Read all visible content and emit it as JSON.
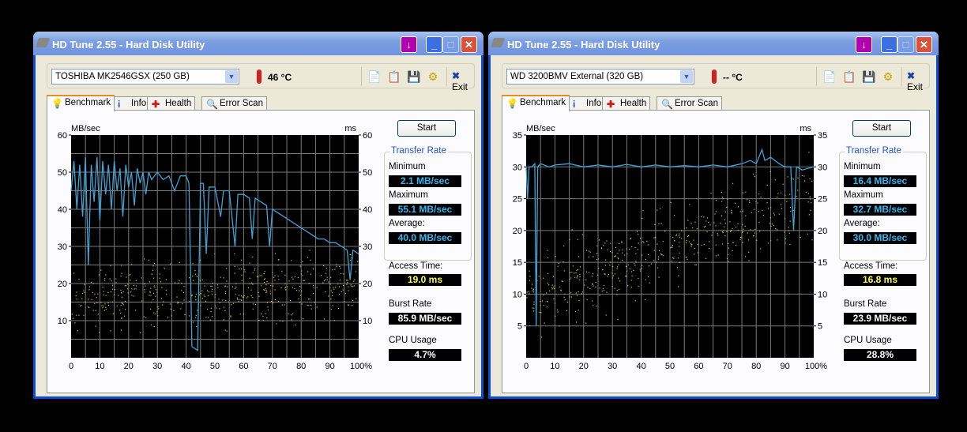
{
  "windows": [
    {
      "title": "HD Tune 2.55 - Hard Disk Utility",
      "drive": "TOSHIBA MK2546GSX (250 GB)",
      "temperature": "46 °C",
      "exit_label": "Exit",
      "tabs": [
        "Benchmark",
        "Info",
        "Health",
        "Error Scan"
      ],
      "start_label": "Start",
      "transfer_rate_label": "Transfer Rate",
      "minimum_label": "Minimum",
      "minimum": "2.1 MB/sec",
      "maximum_label": "Maximum",
      "maximum": "55.1 MB/sec",
      "average_label": "Average:",
      "average": "40.0 MB/sec",
      "access_time_label": "Access Time:",
      "access_time": "19.0 ms",
      "burst_rate_label": "Burst Rate",
      "burst_rate": "85.9 MB/sec",
      "cpu_usage_label": "CPU Usage",
      "cpu_usage": "4.7%"
    },
    {
      "title": "HD Tune 2.55 - Hard Disk Utility",
      "drive": "WD     3200BMV External (320 GB)",
      "temperature": "-- °C",
      "exit_label": "Exit",
      "tabs": [
        "Benchmark",
        "Info",
        "Health",
        "Error Scan"
      ],
      "start_label": "Start",
      "transfer_rate_label": "Transfer Rate",
      "minimum_label": "Minimum",
      "minimum": "16.4 MB/sec",
      "maximum_label": "Maximum",
      "maximum": "32.7 MB/sec",
      "average_label": "Average:",
      "average": "30.0 MB/sec",
      "access_time_label": "Access Time:",
      "access_time": "16.8 ms",
      "burst_rate_label": "Burst Rate",
      "burst_rate": "23.9 MB/sec",
      "cpu_usage_label": "CPU Usage",
      "cpu_usage": "28.8%"
    }
  ],
  "colors": {
    "line": "#3FA3D8",
    "scatter": "#C8C848",
    "grid": "#7A7A7A"
  },
  "chart_data": [
    {
      "type": "line",
      "ylabel": "MB/sec",
      "y2label": "ms",
      "ylim": [
        0,
        60
      ],
      "y2lim": [
        0,
        60
      ],
      "xlim": [
        0,
        100
      ],
      "yticks": [
        "10",
        "20",
        "30",
        "40",
        "50",
        "60"
      ],
      "y2ticks": [
        "10",
        "20",
        "30",
        "40",
        "50",
        "60"
      ],
      "xticks": [
        "0",
        "10",
        "20",
        "30",
        "40",
        "50",
        "60",
        "70",
        "80",
        "90",
        "100%"
      ],
      "transfer_rate": [
        [
          0,
          45
        ],
        [
          1,
          53
        ],
        [
          2,
          40
        ],
        [
          3,
          52
        ],
        [
          4,
          38
        ],
        [
          5,
          54
        ],
        [
          6,
          25
        ],
        [
          7,
          52
        ],
        [
          8,
          42
        ],
        [
          9,
          54
        ],
        [
          10,
          37
        ],
        [
          11,
          53
        ],
        [
          12,
          44
        ],
        [
          13,
          52
        ],
        [
          14,
          40
        ],
        [
          15,
          53
        ],
        [
          16,
          45
        ],
        [
          17,
          51
        ],
        [
          18,
          38
        ],
        [
          19,
          52
        ],
        [
          20,
          46
        ],
        [
          21,
          50
        ],
        [
          22,
          41
        ],
        [
          23,
          51
        ],
        [
          24,
          47
        ],
        [
          25,
          50
        ],
        [
          26,
          44
        ],
        [
          27,
          50
        ],
        [
          28,
          48
        ],
        [
          30,
          50
        ],
        [
          32,
          48
        ],
        [
          34,
          49
        ],
        [
          36,
          45
        ],
        [
          38,
          49
        ],
        [
          40,
          49
        ],
        [
          41,
          47
        ],
        [
          42,
          3
        ],
        [
          44,
          2
        ],
        [
          45,
          47
        ],
        [
          46,
          47
        ],
        [
          47,
          28
        ],
        [
          48,
          46
        ],
        [
          50,
          46
        ],
        [
          52,
          38
        ],
        [
          53,
          45
        ],
        [
          55,
          45
        ],
        [
          57,
          30
        ],
        [
          58,
          44
        ],
        [
          60,
          44
        ],
        [
          62,
          43
        ],
        [
          63,
          32
        ],
        [
          64,
          43
        ],
        [
          66,
          42
        ],
        [
          68,
          41
        ],
        [
          69,
          30
        ],
        [
          70,
          40
        ],
        [
          72,
          39
        ],
        [
          74,
          38
        ],
        [
          76,
          37
        ],
        [
          78,
          36
        ],
        [
          80,
          35
        ],
        [
          82,
          34
        ],
        [
          84,
          33
        ],
        [
          86,
          32
        ],
        [
          88,
          32
        ],
        [
          90,
          31
        ],
        [
          92,
          31
        ],
        [
          94,
          30
        ],
        [
          96,
          29
        ],
        [
          97,
          21
        ],
        [
          98,
          29
        ],
        [
          100,
          28
        ]
      ],
      "access_time_cloud": {
        "count": 500,
        "ms_center_start": 16,
        "ms_center_end": 20,
        "ms_spread": 7
      }
    },
    {
      "type": "line",
      "ylabel": "MB/sec",
      "y2label": "ms",
      "ylim": [
        0,
        35
      ],
      "y2lim": [
        0,
        35
      ],
      "xlim": [
        0,
        100
      ],
      "yticks": [
        "5",
        "10",
        "15",
        "20",
        "25",
        "30",
        "35"
      ],
      "y2ticks": [
        "5",
        "10",
        "15",
        "20",
        "25",
        "30",
        "35"
      ],
      "xticks": [
        "0",
        "10",
        "20",
        "30",
        "40",
        "50",
        "60",
        "70",
        "80",
        "90",
        "100%"
      ],
      "transfer_rate": [
        [
          0,
          30
        ],
        [
          0.5,
          25
        ],
        [
          1,
          30
        ],
        [
          2,
          30
        ],
        [
          3,
          30.5
        ],
        [
          3.5,
          5
        ],
        [
          4,
          30
        ],
        [
          5,
          30.5
        ],
        [
          8,
          30
        ],
        [
          10,
          30.3
        ],
        [
          15,
          30.5
        ],
        [
          20,
          30
        ],
        [
          25,
          30.3
        ],
        [
          30,
          30
        ],
        [
          35,
          30.4
        ],
        [
          40,
          30
        ],
        [
          45,
          30.3
        ],
        [
          50,
          30
        ],
        [
          55,
          30.2
        ],
        [
          60,
          30
        ],
        [
          65,
          30.3
        ],
        [
          70,
          30
        ],
        [
          75,
          30.5
        ],
        [
          78,
          31
        ],
        [
          80,
          30.5
        ],
        [
          82,
          32.7
        ],
        [
          83,
          31
        ],
        [
          85,
          31.5
        ],
        [
          88,
          30.5
        ],
        [
          90,
          30
        ],
        [
          92,
          30
        ],
        [
          93,
          20
        ],
        [
          94,
          30
        ],
        [
          96,
          29.5
        ],
        [
          100,
          30
        ]
      ],
      "access_time_cloud": {
        "count": 500,
        "ms_center_start": 10,
        "ms_center_end": 25,
        "ms_spread": 5
      }
    }
  ]
}
